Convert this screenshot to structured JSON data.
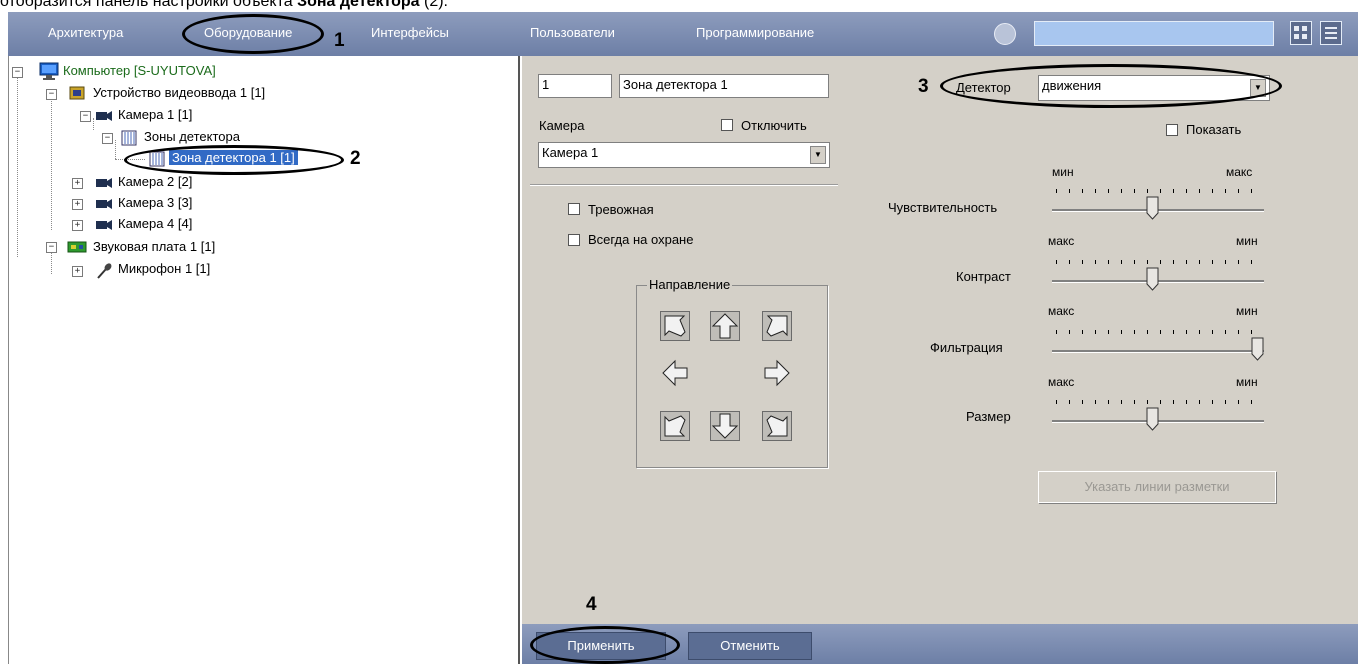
{
  "caption": {
    "prefix": "отобразится панель настройки объекта ",
    "bold": "Зона детектора",
    "suffix": " (2)."
  },
  "menu": {
    "items": [
      "Архитектура",
      "Оборудование",
      "Интерфейсы",
      "Пользователи",
      "Программирование"
    ],
    "search_value": "",
    "accent": "#7b8db3"
  },
  "callouts": {
    "n1": "1",
    "n2": "2",
    "n3": "3",
    "n4": "4"
  },
  "tree": {
    "computer": "Компьютер [S-UYUTOVA]",
    "video_device": "Устройство видеоввода 1 [1]",
    "camera1": "Камера 1 [1]",
    "zones": "Зоны детектора",
    "zone1": "Зона детектора 1 [1]",
    "camera2": "Камера 2 [2]",
    "camera3": "Камера 3 [3]",
    "camera4": "Камера 4 [4]",
    "sound_card": "Звуковая плата 1 [1]",
    "microphone": "Микрофон 1 [1]"
  },
  "panel": {
    "id_value": "1",
    "name_value": "Зона детектора 1",
    "camera_label": "Камера",
    "disable_label": "Отключить",
    "camera_select": "Камера 1",
    "alarm_label": "Тревожная",
    "always_armed_label": "Всегда на охране",
    "direction_label": "Направление",
    "detector_label": "Детектор",
    "detector_value": "движения",
    "show_label": "Показать",
    "sliders": [
      {
        "label": "Чувствительность",
        "left": "мин",
        "right": "макс",
        "level": 0.47
      },
      {
        "label": "Контраст",
        "left": "макс",
        "right": "мин",
        "level": 0.47
      },
      {
        "label": "Фильтрация",
        "left": "макс",
        "right": "мин",
        "level": 1.0
      },
      {
        "label": "Размер",
        "left": "макс",
        "right": "мин",
        "level": 0.47
      }
    ],
    "markup_button": "Указать линии разметки",
    "apply_button": "Применить",
    "cancel_button": "Отменить"
  }
}
